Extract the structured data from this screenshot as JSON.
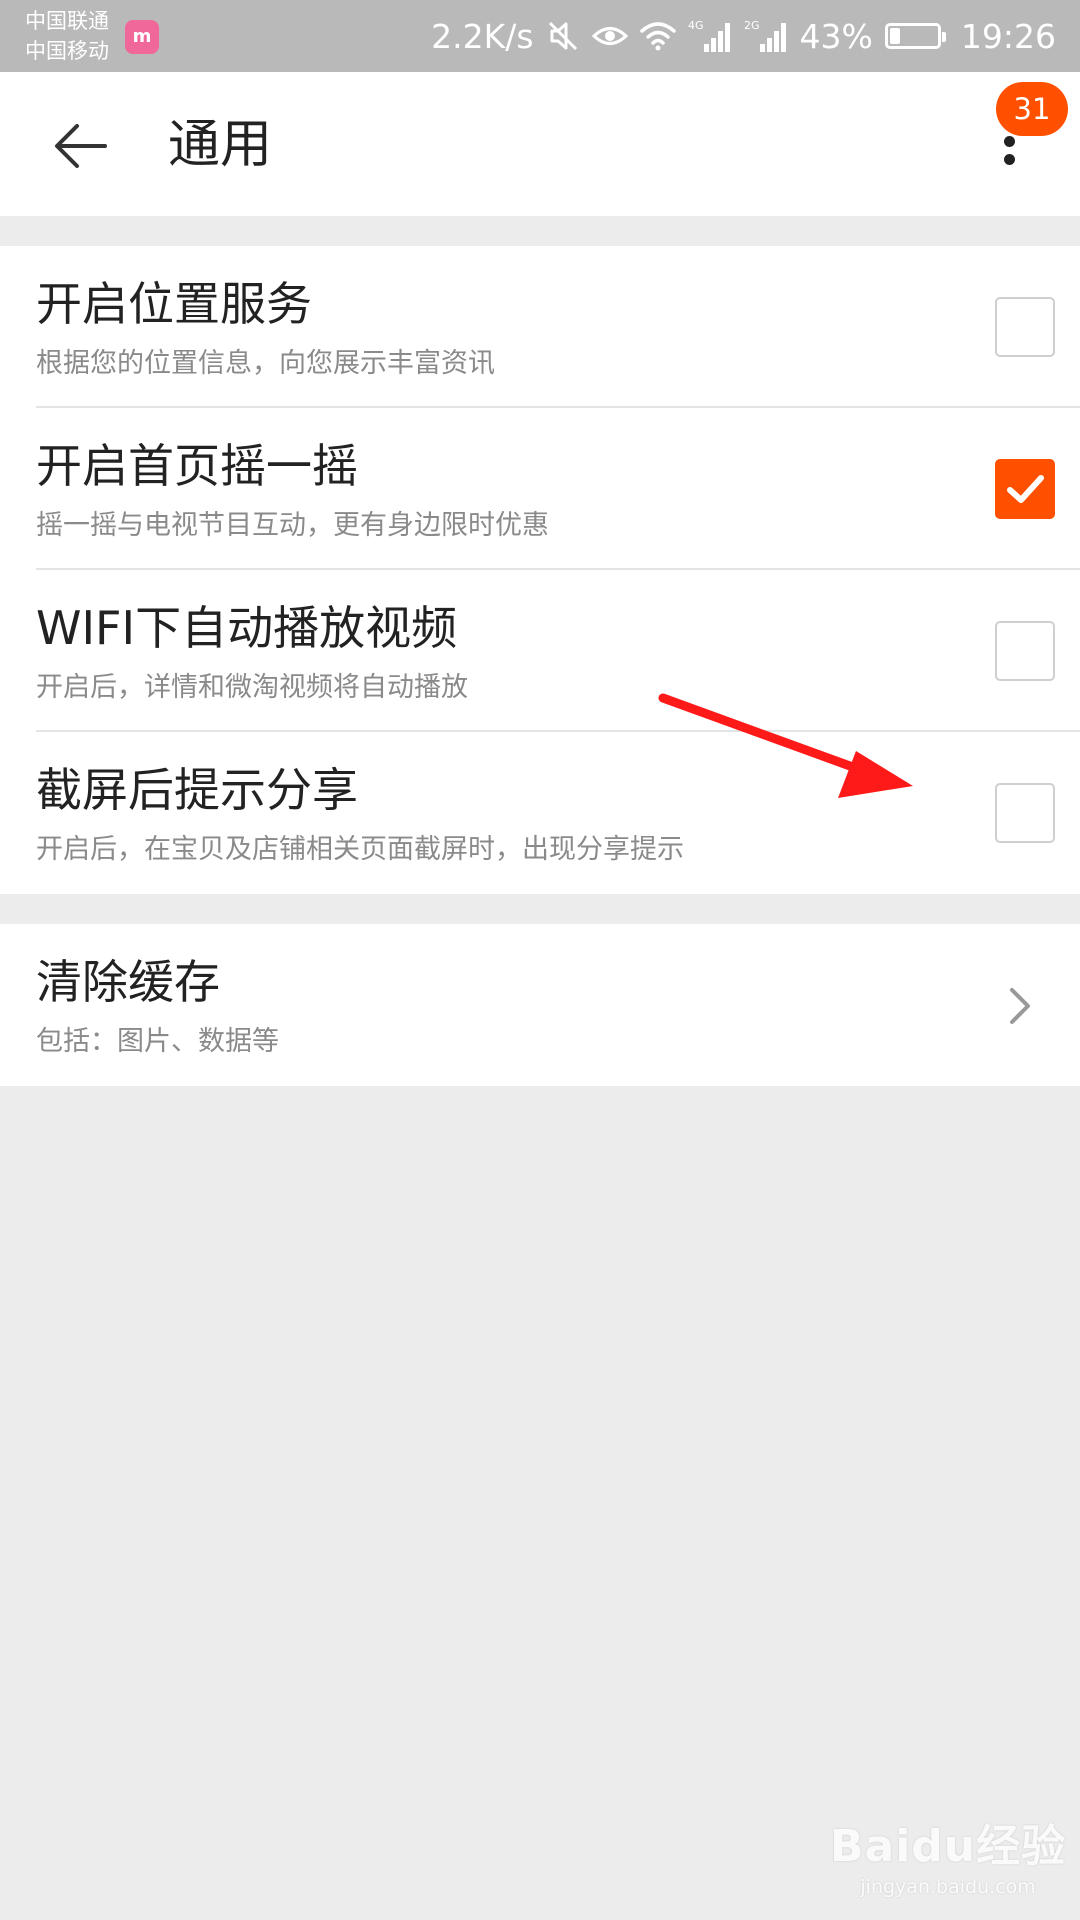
{
  "status_bar": {
    "carrier_1": "中国联通",
    "carrier_2": "中国移动",
    "carrier_badge": "m",
    "network_speed": "2.2K/s",
    "signal_1_label": "4G",
    "signal_2_label": "2G",
    "battery_percent": "43%",
    "battery_level": 0.43,
    "time": "19:26",
    "icons": [
      "mute-icon",
      "eye-icon",
      "wifi-icon",
      "signal-4g-icon",
      "signal-2g-icon",
      "battery-icon"
    ]
  },
  "app_bar": {
    "title": "通用",
    "notification_count": "31",
    "accent_color": "#ff5000"
  },
  "settings": {
    "items": [
      {
        "title": "开启位置服务",
        "subtitle": "根据您的位置信息，向您展示丰富资讯",
        "checked": false
      },
      {
        "title": "开启首页摇一摇",
        "subtitle": "摇一摇与电视节目互动，更有身边限时优惠",
        "checked": true
      },
      {
        "title": "WIFI下自动播放视频",
        "subtitle": "开启后，详情和微淘视频将自动播放",
        "checked": false
      },
      {
        "title": "截屏后提示分享",
        "subtitle": "开启后，在宝贝及店铺相关页面截屏时，出现分享提示",
        "checked": false
      }
    ],
    "cache": {
      "title": "清除缓存",
      "subtitle": "包括：图片、数据等"
    }
  },
  "annotation": {
    "arrow_color": "#ff1a1a"
  },
  "watermark": {
    "logo": "Baidu经验",
    "url": "jingyan.baidu.com"
  }
}
